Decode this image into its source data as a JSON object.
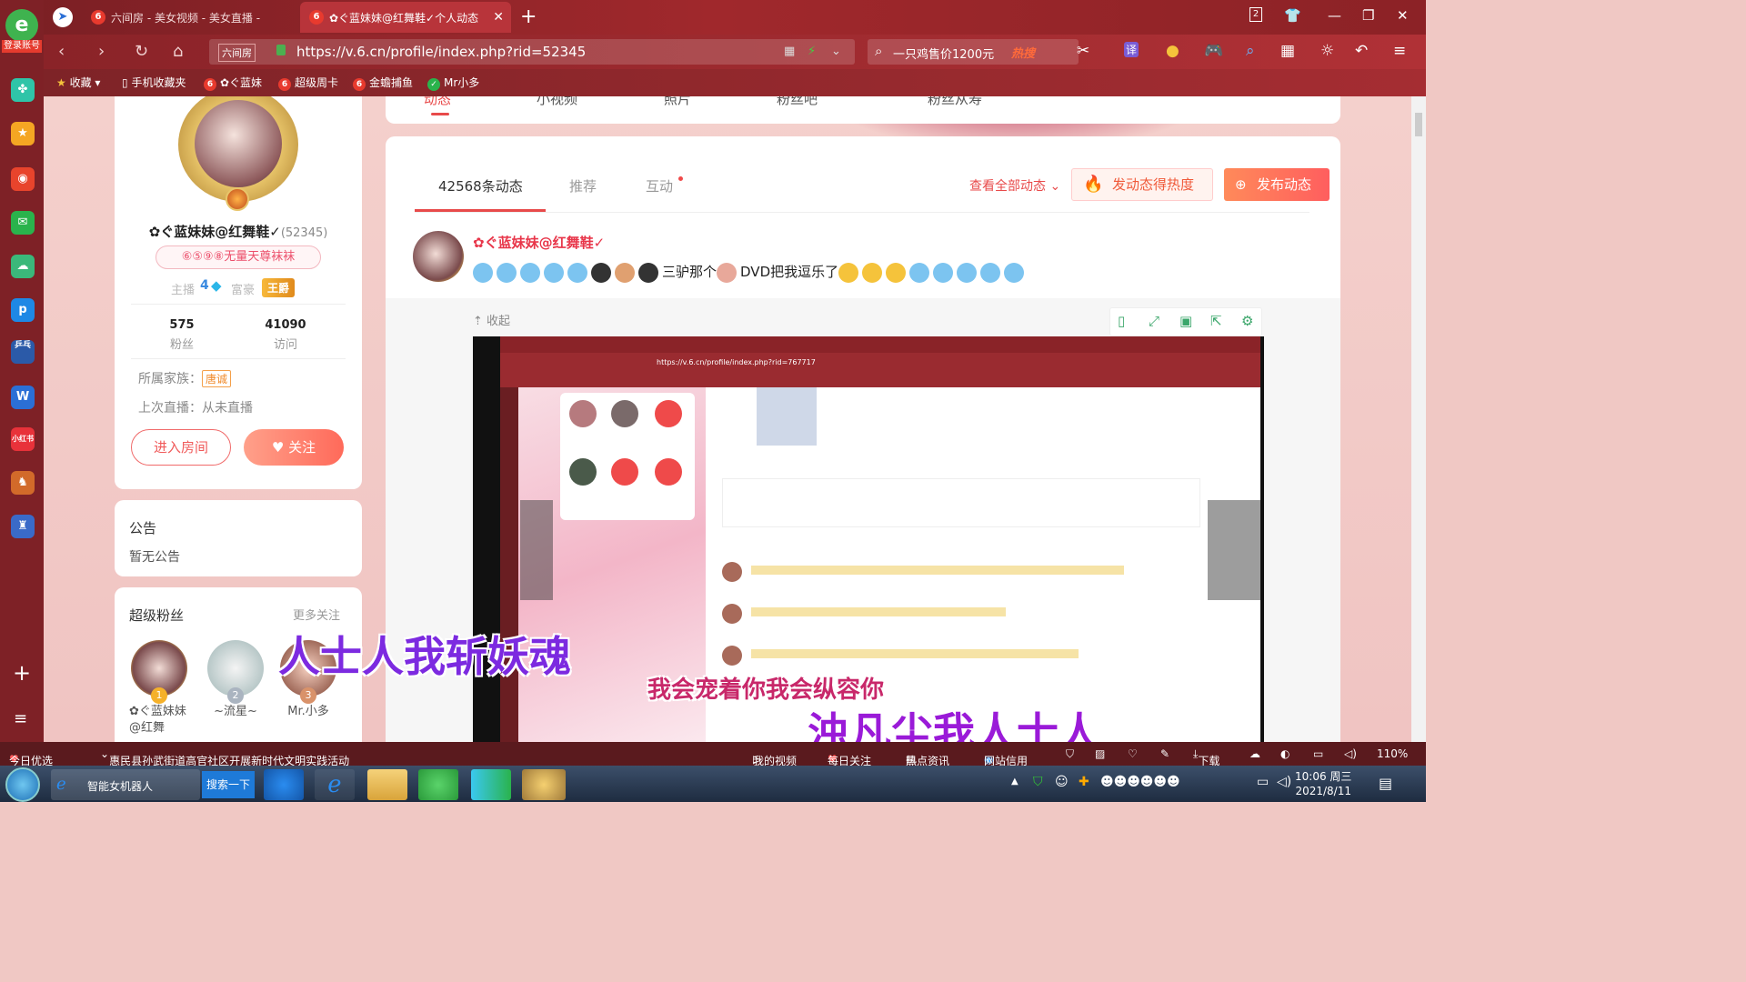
{
  "browser": {
    "tabs": [
      {
        "label": "六间房 - 美女视频 - 美女直播 -"
      },
      {
        "label": "✿ぐ蓝妹妹@红舞鞋✓个人动态"
      }
    ],
    "url": "https://v.6.cn/profile/index.php?rid=52345",
    "url_badge": "六间房",
    "search_query": "一只鸡售价1200元",
    "search_hot": "热搜",
    "bookmarks": [
      "收藏",
      "手机收藏夹",
      "✿ぐ蓝妹",
      "超级周卡",
      "金蟾捕鱼",
      "Mr小多"
    ],
    "sidebar_login": "登录账号",
    "sidebar_app_labels": {
      "ping": "乒乓",
      "p6": "图表",
      "word": "W",
      "xhs": "小红书"
    }
  },
  "profile": {
    "name": "✿ぐ蓝妹妹@红舞鞋✓",
    "rid": "(52345)",
    "uid_badge": "⑥⑤⑨⑧无量天尊袜袜",
    "host_label": "主播",
    "host_level": "4",
    "rich_label": "富豪",
    "rich_title": "王爵",
    "fans_count": "575",
    "fans_label": "粉丝",
    "visits_count": "41090",
    "visits_label": "访问",
    "family_label": "所属家族：",
    "family_name": "唐诚",
    "last_live": "上次直播：从未直播",
    "enter_room": "进入房间",
    "follow": "关注"
  },
  "notice": {
    "title": "公告",
    "text": "暂无公告"
  },
  "super_fans": {
    "title": "超级粉丝",
    "more": "更多关注",
    "fans": [
      {
        "rank": "1",
        "name": "✿ぐ蓝妹妹@红舞"
      },
      {
        "rank": "2",
        "name": "~流星~"
      },
      {
        "rank": "3",
        "name": "Mr.小多"
      }
    ]
  },
  "top_nav": [
    "动态",
    "小视频",
    "照片",
    "粉丝吧",
    "粉丝从寿"
  ],
  "feed": {
    "tabs": [
      "42568条动态",
      "推荐",
      "互动"
    ],
    "see_all": "查看全部动态",
    "heat_button": "发动态得热度",
    "post_button": "发布动态",
    "post_author": "✿ぐ蓝妹妹@红舞鞋✓",
    "post_text_a": "三驴那个",
    "post_text_b": "DVD把我逗乐了",
    "collapse": "收起"
  },
  "video": {
    "url": "https://v.6.cn/profile/index.php?rid=767717"
  },
  "lyrics": {
    "line1": "人士人我斩妖魂",
    "line2": "我会宠着你我会纵容你",
    "line3": "浊凡尘我人士人"
  },
  "statusbar": {
    "news_label": "今日优选",
    "news": "惠民县孙武街道高官社区开展新时代文明实践活动",
    "items": [
      "我的视频",
      "每日关注",
      "热点资讯",
      "网站信用"
    ],
    "download": "下载",
    "zoom": "110%"
  },
  "taskbar": {
    "app": "智能女机器人",
    "search": "搜索一下",
    "time": "10:06 周三",
    "date": "2021/8/11"
  },
  "colors": {
    "accent": "#e84a4a",
    "chrome": "#9a272c",
    "follow": "#ff6a5a"
  }
}
